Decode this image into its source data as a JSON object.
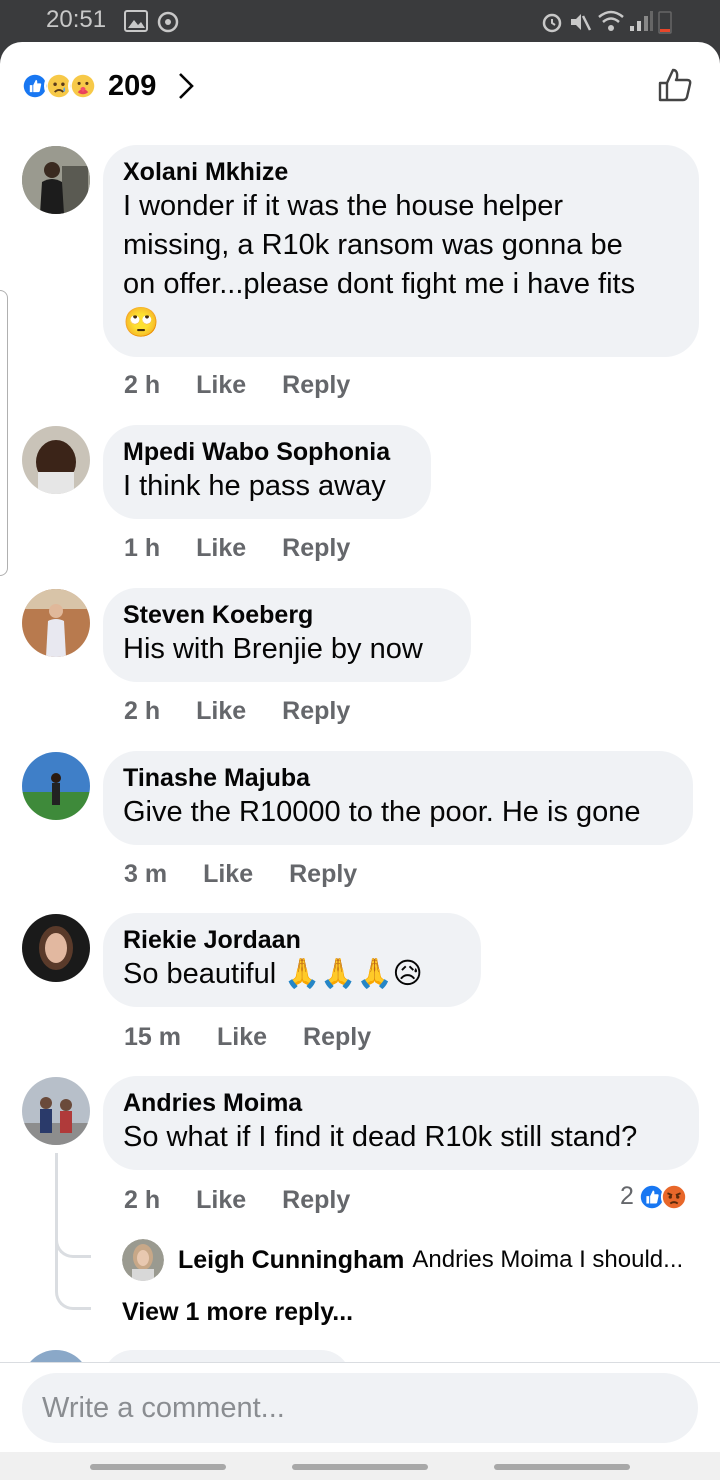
{
  "status_bar": {
    "time": "20:51"
  },
  "header": {
    "reaction_count": "209",
    "reaction_icons": [
      "like-icon",
      "sad-icon",
      "care-icon"
    ]
  },
  "comments": [
    {
      "author": "Xolani Mkhize",
      "lines": [
        "I wonder if it was the house helper",
        "missing, a R10k ransom was gonna be",
        "on offer...please dont fight me i have fits",
        "🙄"
      ],
      "time": "2 h",
      "like": "Like",
      "reply": "Reply"
    },
    {
      "author": "Mpedi Wabo Sophonia",
      "lines": [
        "I think he pass away"
      ],
      "time": "1 h",
      "like": "Like",
      "reply": "Reply"
    },
    {
      "author": "Steven Koeberg",
      "lines": [
        "His with Brenjie by now"
      ],
      "time": "2 h",
      "like": "Like",
      "reply": "Reply"
    },
    {
      "author": "Tinashe Majuba",
      "lines": [
        "Give the R10000 to the poor. He is gone"
      ],
      "time": "3 m",
      "like": "Like",
      "reply": "Reply"
    },
    {
      "author": "Riekie Jordaan",
      "lines": [
        "So beautiful 🙏🙏🙏😥"
      ],
      "time": "15 m",
      "like": "Like",
      "reply": "Reply"
    },
    {
      "author": "Andries Moima",
      "lines": [
        "So what if I find it dead R10k still stand?"
      ],
      "time": "2 h",
      "like": "Like",
      "reply": "Reply",
      "reaction_count": "2",
      "reaction_icons": [
        "like-icon",
        "angry-icon"
      ]
    }
  ],
  "reply_preview": {
    "author": "Leigh Cunningham",
    "snippet": "Andries Moima I should..."
  },
  "view_more": "View 1 more reply...",
  "composer": {
    "placeholder": "Write a comment..."
  },
  "colors": {
    "bubble": "#f0f2f5",
    "meta": "#65676b",
    "like_blue": "#1877f2",
    "text": "#050505"
  }
}
